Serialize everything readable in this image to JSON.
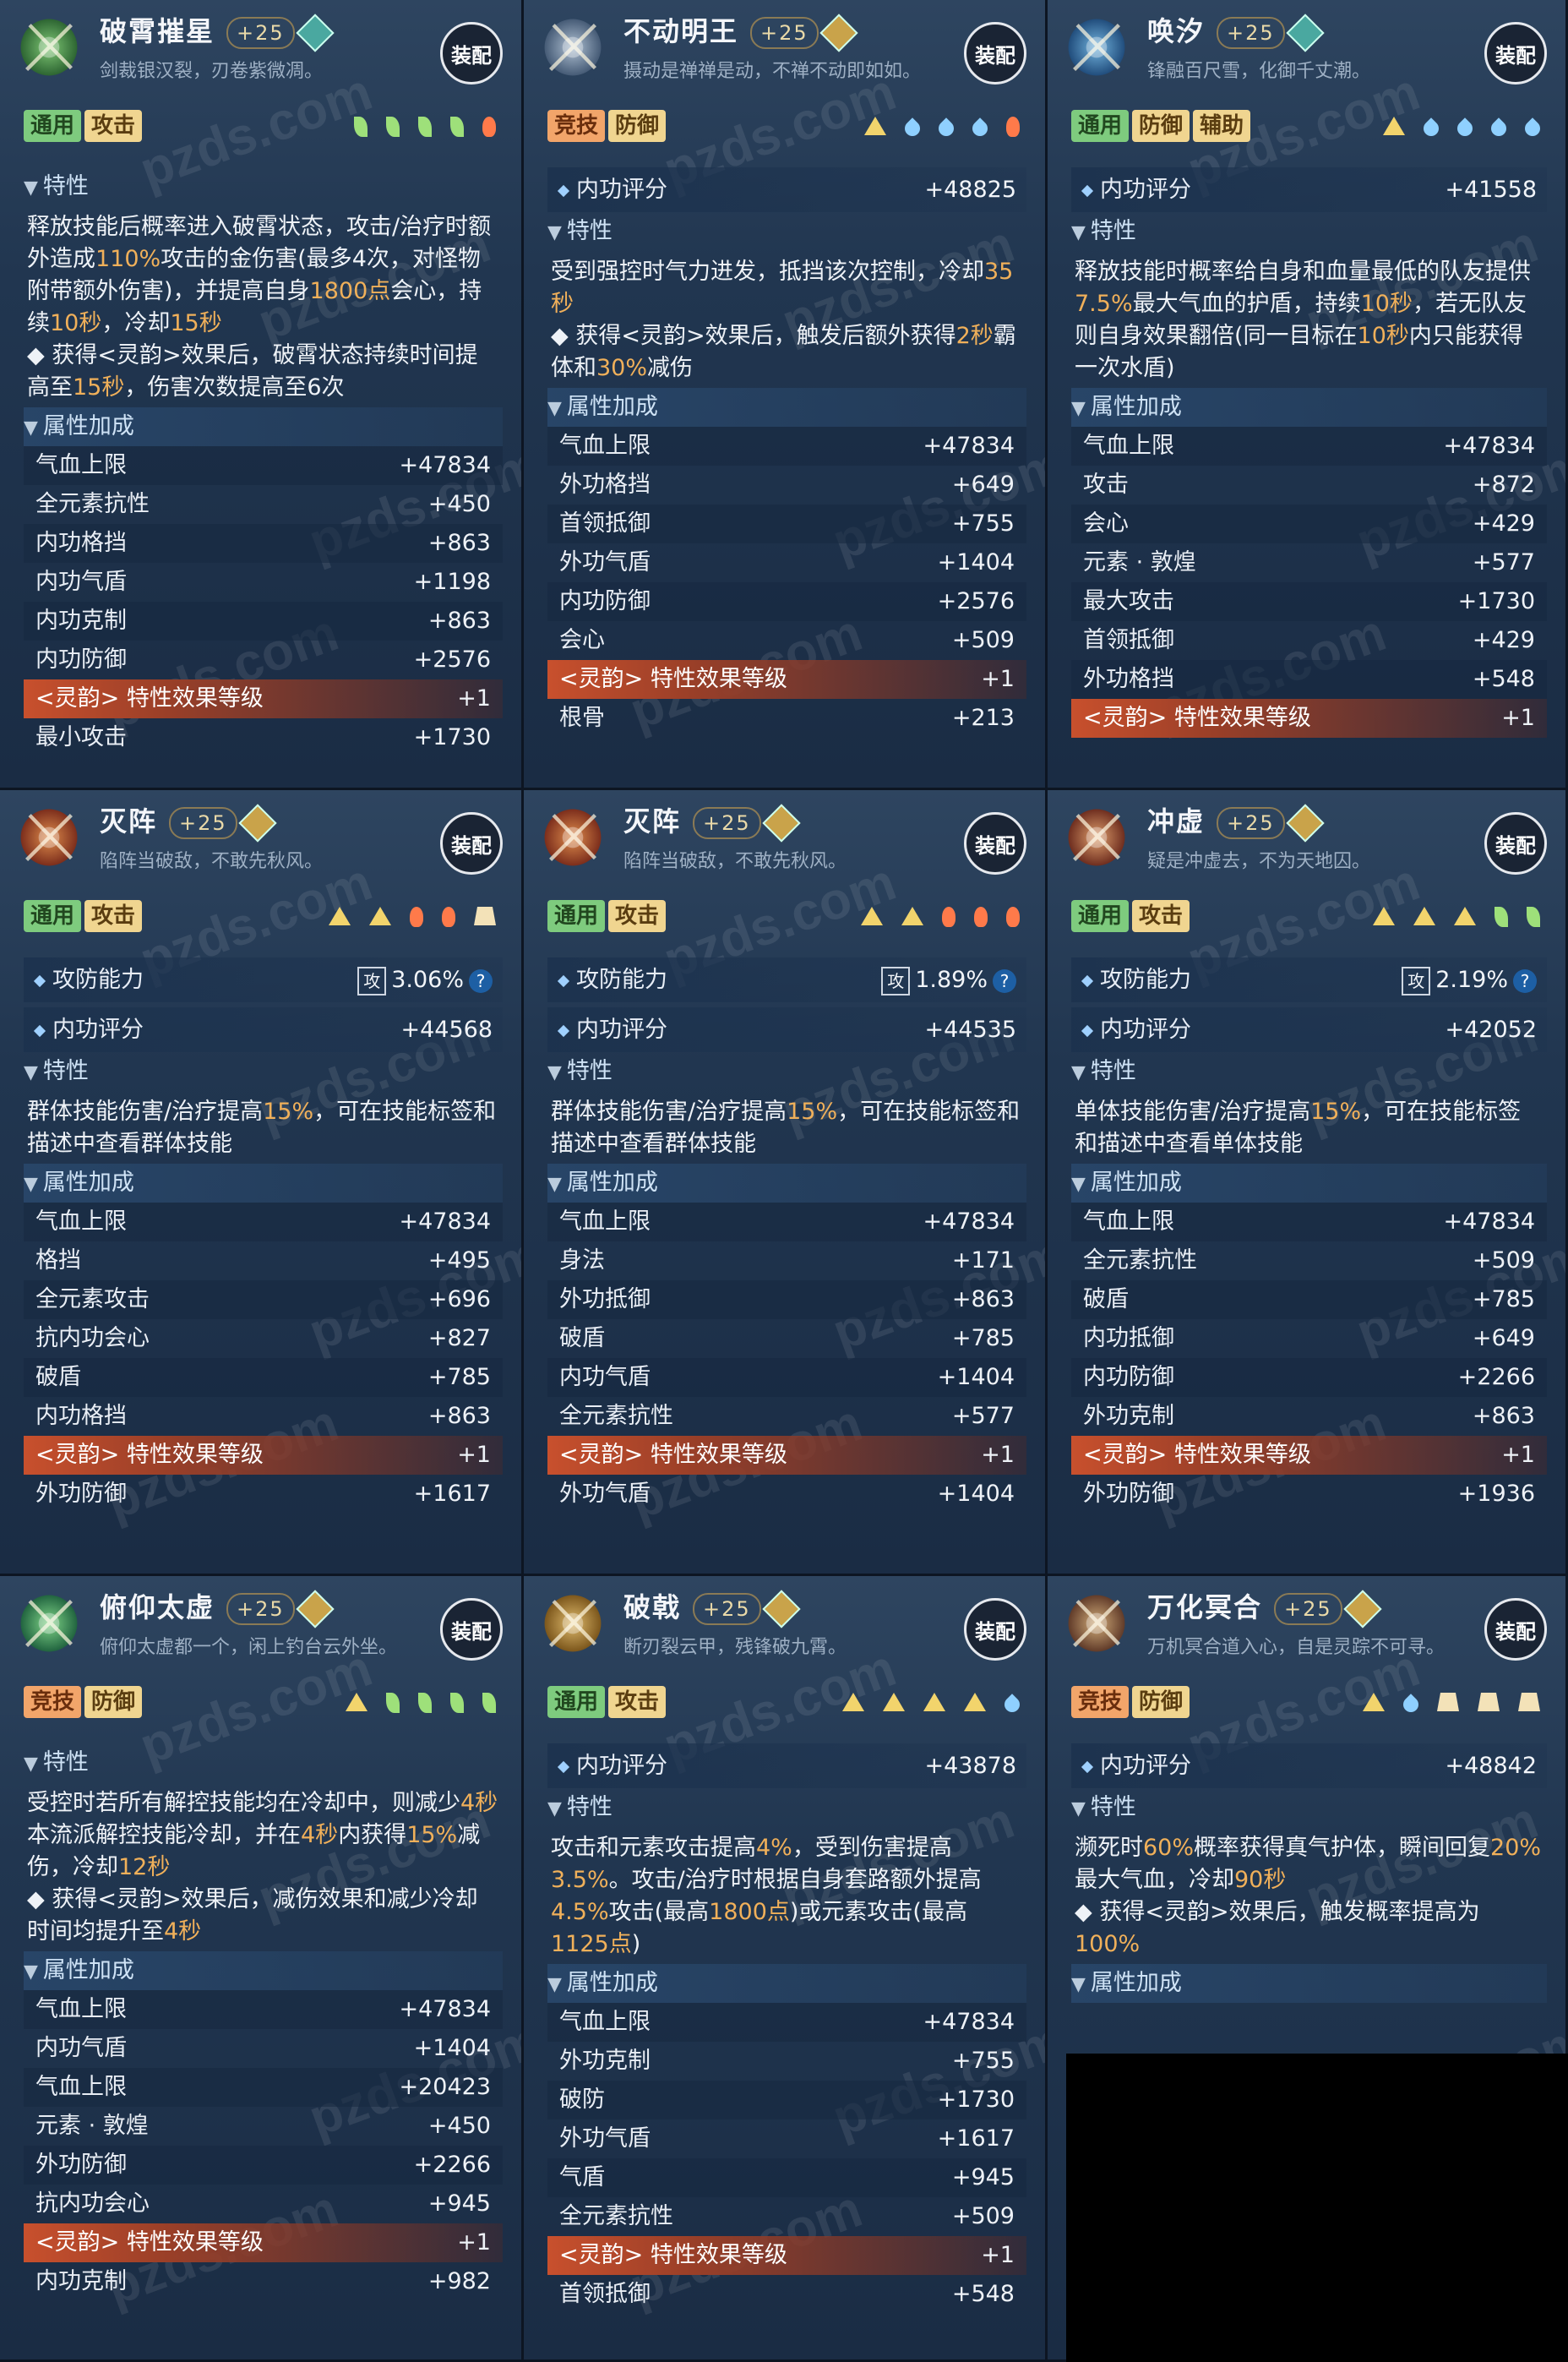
{
  "ui": {
    "equip_label": "装配",
    "sec_trait": "特性",
    "sec_attr": "属性加成",
    "sec_neigong": "内功评分",
    "sec_gongfang": "攻防能力",
    "gong_char": "攻",
    "q_mark": "?",
    "watermark": "pzds.com"
  },
  "cards": [
    {
      "name": "破霄摧星",
      "level": "+25",
      "gem": "g",
      "quote": "剑裁银汉裂，刃卷紫微凋。",
      "tags": [
        {
          "t": "通用",
          "c": "g"
        },
        {
          "t": "攻击",
          "c": "y"
        }
      ],
      "gems": [
        "leaf",
        "leaf",
        "leaf",
        "leaf",
        "flame"
      ],
      "gongfang": null,
      "neigong": null,
      "desc": "释放技能后概率进入破霄状态，攻击/治疗时额外造成110%攻击的金伤害(最多4次，对怪物附带额外伤害)，并提高自身1800点会心，持续10秒，冷却15秒\n◆ 获得<灵韵>效果后，破霄状态持续时间提高至15秒，伤害次数提高至6次",
      "stats": [
        [
          "气血上限",
          "+47834"
        ],
        [
          "全元素抗性",
          "+450"
        ],
        [
          "内功格挡",
          "+863"
        ],
        [
          "内功气盾",
          "+1198"
        ],
        [
          "内功克制",
          "+863"
        ],
        [
          "内功防御",
          "+2576"
        ],
        [
          "<灵韵> 特性效果等级",
          "+1"
        ],
        [
          "最小攻击",
          "+1730"
        ]
      ]
    },
    {
      "name": "不动明王",
      "level": "+25",
      "gem": "o",
      "quote": "摄动是禅禅是动，不禅不动即如如。",
      "tags": [
        {
          "t": "竞技",
          "c": "o"
        },
        {
          "t": "防御",
          "c": "y"
        }
      ],
      "gems": [
        "tri",
        "drop",
        "drop",
        "drop",
        "flame"
      ],
      "gongfang": null,
      "neigong": "+48825",
      "desc": "受到强控时气力进发，抵挡该次控制，冷却35秒\n◆ 获得<灵韵>效果后，触发后额外获得2秒霸体和30%减伤",
      "stats": [
        [
          "气血上限",
          "+47834"
        ],
        [
          "外功格挡",
          "+649"
        ],
        [
          "首领抵御",
          "+755"
        ],
        [
          "外功气盾",
          "+1404"
        ],
        [
          "内功防御",
          "+2576"
        ],
        [
          "会心",
          "+509"
        ],
        [
          "<灵韵> 特性效果等级",
          "+1"
        ],
        [
          "根骨",
          "+213"
        ]
      ]
    },
    {
      "name": "唤汐",
      "level": "+25",
      "gem": "g",
      "quote": "锋融百尺雪，化御千丈潮。",
      "tags": [
        {
          "t": "通用",
          "c": "g"
        },
        {
          "t": "防御",
          "c": "y"
        },
        {
          "t": "辅助",
          "c": "y"
        }
      ],
      "gems": [
        "tri",
        "drop",
        "drop",
        "drop",
        "drop"
      ],
      "gongfang": null,
      "neigong": "+41558",
      "desc": "释放技能时概率给自身和血量最低的队友提供7.5%最大气血的护盾，持续10秒，若无队友则自身效果翻倍(同一目标在10秒内只能获得一次水盾)",
      "stats": [
        [
          "气血上限",
          "+47834"
        ],
        [
          "攻击",
          "+872"
        ],
        [
          "会心",
          "+429"
        ],
        [
          "元素 · 敦煌",
          "+577"
        ],
        [
          "最大攻击",
          "+1730"
        ],
        [
          "首领抵御",
          "+429"
        ],
        [
          "外功格挡",
          "+548"
        ],
        [
          "<灵韵> 特性效果等级",
          "+1"
        ]
      ]
    },
    {
      "name": "灭阵",
      "level": "+25",
      "gem": "o",
      "quote": "陷阵当破敌，不敢先秋风。",
      "tags": [
        {
          "t": "通用",
          "c": "g"
        },
        {
          "t": "攻击",
          "c": "y"
        }
      ],
      "gems": [
        "tri",
        "tri",
        "flame",
        "flame",
        "trap"
      ],
      "gongfang": "3.06%",
      "neigong": "+44568",
      "desc": "群体技能伤害/治疗提高15%，可在技能标签和描述中查看群体技能",
      "stats": [
        [
          "气血上限",
          "+47834"
        ],
        [
          "格挡",
          "+495"
        ],
        [
          "全元素攻击",
          "+696"
        ],
        [
          "抗内功会心",
          "+827"
        ],
        [
          "破盾",
          "+785"
        ],
        [
          "内功格挡",
          "+863"
        ],
        [
          "<灵韵> 特性效果等级",
          "+1"
        ],
        [
          "外功防御",
          "+1617"
        ]
      ]
    },
    {
      "name": "灭阵",
      "level": "+25",
      "gem": "o",
      "quote": "陷阵当破敌，不敢先秋风。",
      "tags": [
        {
          "t": "通用",
          "c": "g"
        },
        {
          "t": "攻击",
          "c": "y"
        }
      ],
      "gems": [
        "tri",
        "tri",
        "flame",
        "flame",
        "flame"
      ],
      "gongfang": "1.89%",
      "neigong": "+44535",
      "desc": "群体技能伤害/治疗提高15%，可在技能标签和描述中查看群体技能",
      "stats": [
        [
          "气血上限",
          "+47834"
        ],
        [
          "身法",
          "+171"
        ],
        [
          "外功抵御",
          "+863"
        ],
        [
          "破盾",
          "+785"
        ],
        [
          "内功气盾",
          "+1404"
        ],
        [
          "全元素抗性",
          "+577"
        ],
        [
          "<灵韵> 特性效果等级",
          "+1"
        ],
        [
          "外功气盾",
          "+1404"
        ]
      ]
    },
    {
      "name": "冲虚",
      "level": "+25",
      "gem": "o",
      "quote": "疑是冲虚去，不为天地囚。",
      "tags": [
        {
          "t": "通用",
          "c": "g"
        },
        {
          "t": "攻击",
          "c": "y"
        }
      ],
      "gems": [
        "tri",
        "tri",
        "tri",
        "leaf",
        "leaf"
      ],
      "gongfang": "2.19%",
      "neigong": "+42052",
      "desc": "单体技能伤害/治疗提高15%，可在技能标签和描述中查看单体技能",
      "stats": [
        [
          "气血上限",
          "+47834"
        ],
        [
          "全元素抗性",
          "+509"
        ],
        [
          "破盾",
          "+785"
        ],
        [
          "内功抵御",
          "+649"
        ],
        [
          "内功防御",
          "+2266"
        ],
        [
          "外功克制",
          "+863"
        ],
        [
          "<灵韵> 特性效果等级",
          "+1"
        ],
        [
          "外功防御",
          "+1936"
        ]
      ]
    },
    {
      "name": "俯仰太虚",
      "level": "+25",
      "gem": "o",
      "quote": "俯仰太虚都一个，闲上钓台云外坐。",
      "tags": [
        {
          "t": "竞技",
          "c": "o"
        },
        {
          "t": "防御",
          "c": "y"
        }
      ],
      "gems": [
        "tri",
        "leaf",
        "leaf",
        "leaf",
        "leaf"
      ],
      "gongfang": null,
      "neigong": null,
      "desc": "受控时若所有解控技能均在冷却中，则减少4秒本流派解控技能冷却，并在4秒内获得15%减伤，冷却12秒\n◆ 获得<灵韵>效果后，减伤效果和减少冷却时间均提升至4秒",
      "stats": [
        [
          "气血上限",
          "+47834"
        ],
        [
          "内功气盾",
          "+1404"
        ],
        [
          "气血上限",
          "+20423"
        ],
        [
          "元素 · 敦煌",
          "+450"
        ],
        [
          "外功防御",
          "+2266"
        ],
        [
          "抗内功会心",
          "+945"
        ],
        [
          "<灵韵> 特性效果等级",
          "+1"
        ],
        [
          "内功克制",
          "+982"
        ]
      ]
    },
    {
      "name": "破戟",
      "level": "+25",
      "gem": "o",
      "quote": "断刃裂云甲，残锋破九霄。",
      "tags": [
        {
          "t": "通用",
          "c": "g"
        },
        {
          "t": "攻击",
          "c": "y"
        }
      ],
      "gems": [
        "tri",
        "tri",
        "tri",
        "tri",
        "drop"
      ],
      "gongfang": null,
      "neigong": "+43878",
      "desc": "攻击和元素攻击提高4%，受到伤害提高3.5%。攻击/治疗时根据自身套路额外提高4.5%攻击(最高1800点)或元素攻击(最高1125点)",
      "stats": [
        [
          "气血上限",
          "+47834"
        ],
        [
          "外功克制",
          "+755"
        ],
        [
          "破防",
          "+1730"
        ],
        [
          "外功气盾",
          "+1617"
        ],
        [
          "气盾",
          "+945"
        ],
        [
          "全元素抗性",
          "+509"
        ],
        [
          "<灵韵> 特性效果等级",
          "+1"
        ],
        [
          "首领抵御",
          "+548"
        ]
      ]
    },
    {
      "name": "万化冥合",
      "level": "+25",
      "gem": "o",
      "quote": "万机冥合道入心，自是灵踪不可寻。",
      "tags": [
        {
          "t": "竞技",
          "c": "o"
        },
        {
          "t": "防御",
          "c": "y"
        }
      ],
      "gems": [
        "tri",
        "drop",
        "trap",
        "trap",
        "trap"
      ],
      "gongfang": null,
      "neigong": "+48842",
      "desc": "濒死时60%概率获得真气护体，瞬间回复20%最大气血，冷却90秒\n◆ 获得<灵韵>效果后，触发概率提高为100%",
      "stats": []
    }
  ]
}
